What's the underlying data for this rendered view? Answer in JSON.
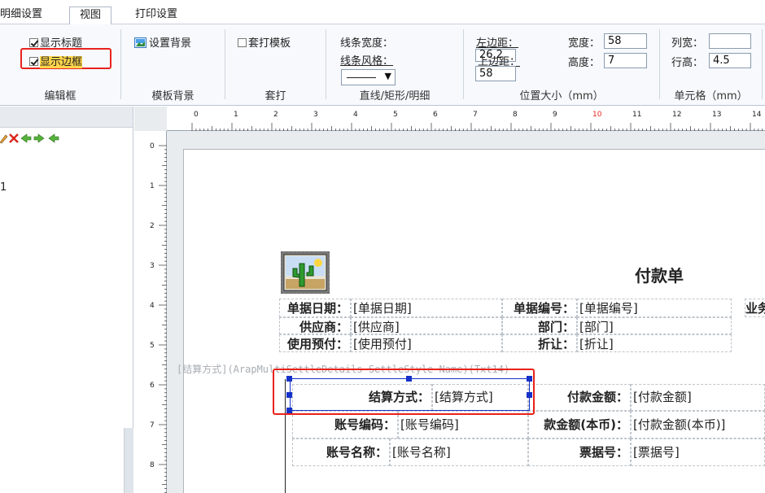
{
  "tabs": {
    "detail_settings": "明细设置",
    "view": "视图",
    "print_settings": "打印设置"
  },
  "ribbon": {
    "edit_frame": {
      "caption": "编辑框",
      "show_title": "显示标题",
      "show_border": "显示边框",
      "show_title_checked": true,
      "show_border_checked": true
    },
    "template_bg": {
      "caption": "模板背景",
      "set_background": "设置背景"
    },
    "overprint": {
      "caption": "套打",
      "overprint_template": "套打模板"
    },
    "line": {
      "caption": "直线/矩形/明细",
      "line_width": "线条宽度：",
      "line_style": "线条风格："
    },
    "position": {
      "caption": "位置大小（mm）",
      "left_margin_label": "左边距：",
      "left_margin_value": "26.2",
      "top_margin_label": "上边距：",
      "top_margin_value": "58",
      "width_label": "宽度：",
      "width_value": "58",
      "height_label": "高度：",
      "height_value": "7"
    },
    "cell": {
      "caption": "单元格（mm）",
      "col_width_label": "列宽：",
      "col_width_value": "",
      "row_height_label": "行高：",
      "row_height_value": "4.5"
    }
  },
  "left_panel": {
    "tree_item": "1"
  },
  "ruler": {
    "top_numbers": [
      "0",
      "1",
      "2",
      "3",
      "4",
      "5",
      "6",
      "7",
      "8",
      "9",
      "10",
      "11",
      "12",
      "13",
      "14"
    ],
    "left_numbers": [
      "0",
      "1",
      "2",
      "3",
      "4",
      "5",
      "6",
      "7",
      "8"
    ]
  },
  "report": {
    "title": "付款单",
    "hint_text": "[结算方式](ArapMultiSettleDetails SettleStyle Name)(Txt14)",
    "row1": {
      "l1": "单据日期：",
      "v1": "[单据日期]",
      "l2": "单据编号：",
      "v2": "[单据编号]",
      "l3": "业务"
    },
    "row2": {
      "l1": "供应商：",
      "v1": "[供应商]",
      "l2": "部门：",
      "v2": "[部门]"
    },
    "row3": {
      "l1": "使用预付：",
      "v1": "[使用预付]",
      "l2": "折让：",
      "v2": "[折让]"
    },
    "detail1": {
      "l1": "结算方式：",
      "v1": "[结算方式]",
      "l2": "付款金额：",
      "v2": "[付款金额]"
    },
    "detail2": {
      "l1": "账号编码：",
      "v1": "[账号编码]",
      "l2": "款金额(本币)：",
      "v2": "[付款金额(本币)]"
    },
    "detail3": {
      "l1": "账号名称：",
      "v1": "[账号名称]",
      "l2": "票据号：",
      "v2": "[票据号]"
    }
  },
  "colors": {
    "highlight_red": "#e8221c",
    "checkbox_highlight": "#ffd54a",
    "ruler_red": "#e8221c",
    "selection_blue": "#1531c8"
  }
}
